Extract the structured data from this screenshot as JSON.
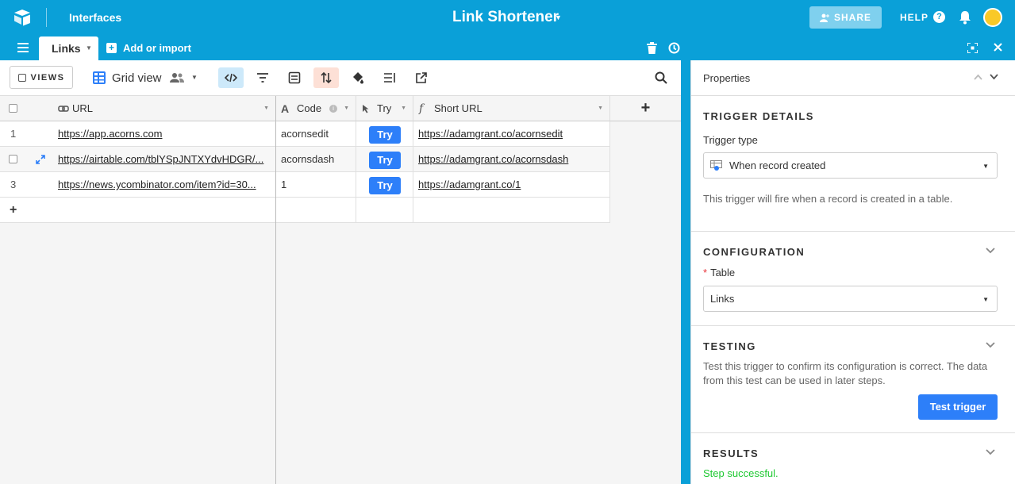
{
  "topbar": {
    "interfaces_label": "Interfaces",
    "base_title": "Link Shortener",
    "share_label": "SHARE",
    "help_label": "HELP",
    "help_icon": "?"
  },
  "tabs": {
    "active_table": "Links",
    "add_import_label": "Add or import"
  },
  "viewbar": {
    "views_label": "VIEWS",
    "view_name": "Grid view"
  },
  "grid": {
    "columns": [
      {
        "label": "URL",
        "icon": "link-field-icon"
      },
      {
        "label": "Code",
        "icon": "text-field-icon"
      },
      {
        "label": "Try",
        "icon": "button-field-icon"
      },
      {
        "label": "Short URL",
        "icon": "formula-field-icon"
      }
    ],
    "rows": [
      {
        "num": "1",
        "url": "https://app.acorns.com",
        "code": "acornsedit",
        "try": "Try",
        "short_url": "https://adamgrant.co/acornsedit"
      },
      {
        "num": "",
        "url": "https://airtable.com/tblYSpJNTXYdvHDGR/...",
        "code": "acornsdash",
        "try": "Try",
        "short_url": "https://adamgrant.co/acornsdash"
      },
      {
        "num": "3",
        "url": "https://news.ycombinator.com/item?id=30...",
        "code": "1",
        "try": "Try",
        "short_url": "https://adamgrant.co/1"
      }
    ],
    "add_row": "+",
    "add_field": "+"
  },
  "panel": {
    "title": "Properties",
    "trigger_details": {
      "heading": "TRIGGER DETAILS",
      "type_label": "Trigger type",
      "type_value": "When record created",
      "description": "This trigger will fire when a record is created in a table."
    },
    "configuration": {
      "heading": "CONFIGURATION",
      "required_mark": "*",
      "table_label": "Table",
      "table_value": "Links"
    },
    "testing": {
      "heading": "TESTING",
      "description": "Test this trigger to confirm its configuration is correct. The data from this test can be used in later steps.",
      "button_label": "Test trigger"
    },
    "results": {
      "heading": "RESULTS",
      "status": "Step successful."
    }
  },
  "colors": {
    "brand": "#0aa0d8",
    "button_blue": "#2d7ff9",
    "success": "#20c933",
    "avatar": "#f9c928"
  }
}
